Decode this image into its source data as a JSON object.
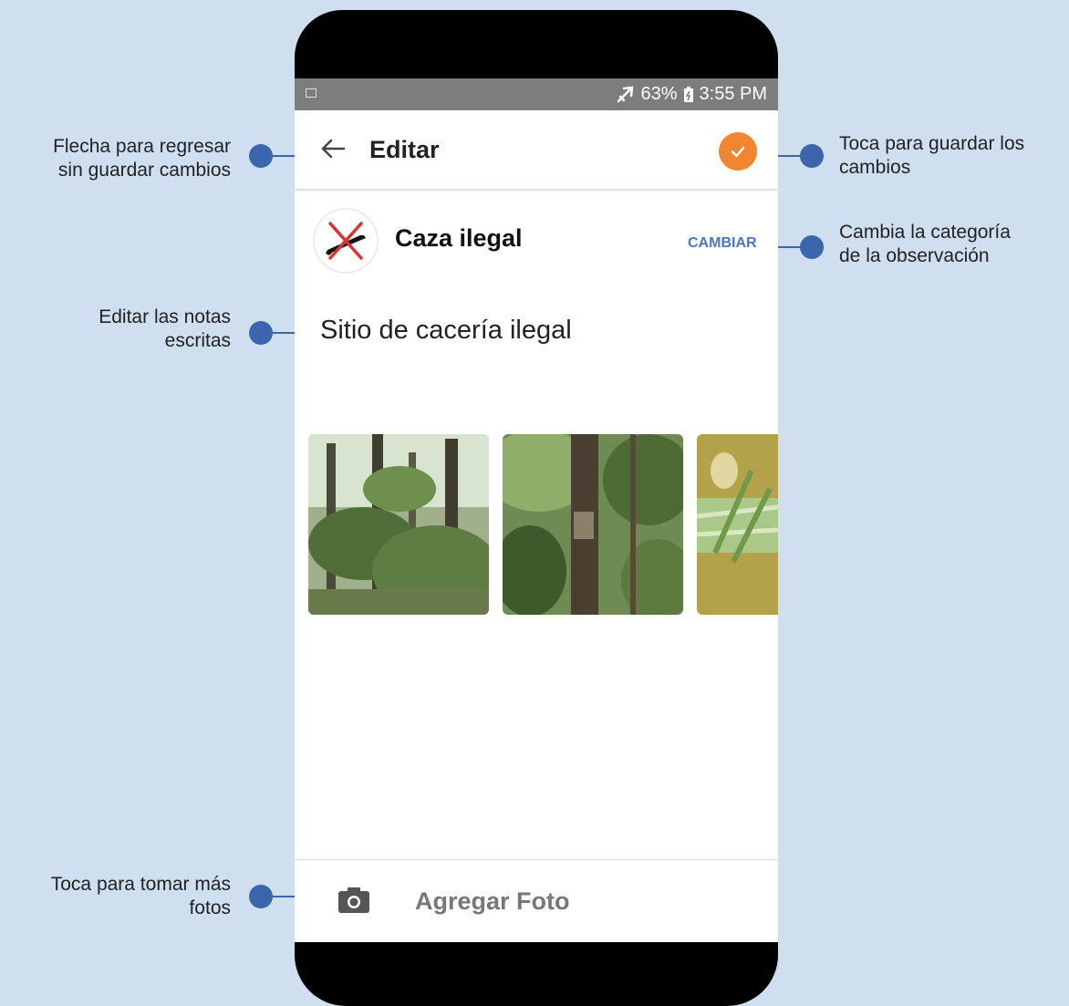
{
  "status_bar": {
    "battery": "63%",
    "time": "3:55 PM"
  },
  "app_bar": {
    "title": "Editar"
  },
  "category": {
    "name": "Caza ilegal",
    "change_label": "CAMBIAR"
  },
  "notes": {
    "text": "Sitio de cacería ilegal"
  },
  "bottom_bar": {
    "add_photo_label": "Agregar Foto"
  },
  "callouts": {
    "back": [
      "Flecha para regresar",
      "sin guardar cambios"
    ],
    "notes": [
      "Editar las notas",
      "escritas"
    ],
    "photo": [
      "Toca para tomar más",
      "fotos"
    ],
    "save": [
      "Toca para guardar los",
      "cambios"
    ],
    "category": [
      "Cambia la categoría",
      "de la observación"
    ]
  },
  "colors": {
    "accent": "#f2852f",
    "link": "#4a78c0",
    "callout": "#3b65ad",
    "background": "#cfdff0"
  },
  "icons": [
    "back-arrow-icon",
    "check-icon",
    "no-hunting-icon",
    "camera-icon",
    "airplane-mode-icon",
    "battery-icon",
    "image-notification-icon"
  ]
}
